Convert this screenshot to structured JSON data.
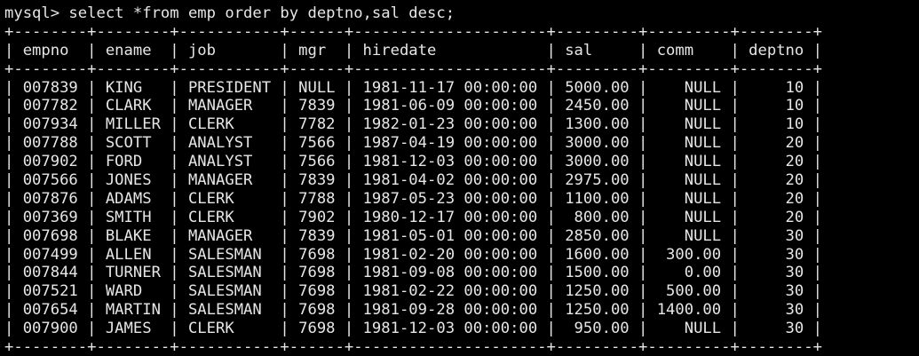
{
  "terminal": {
    "prompt": "mysql> select *from emp order by deptno,sal desc;",
    "border": "+--------+--------+-----------+------+---------------------+---------+---------+--------+",
    "header_row": "| empno  | ename  | job       | mgr  | hiredate            | sal     | comm    | deptno |",
    "columns": [
      "empno",
      "ename",
      "job",
      "mgr",
      "hiredate",
      "sal",
      "comm",
      "deptno"
    ],
    "rows": [
      "| 007839 | KING   | PRESIDENT | NULL | 1981-11-17 00:00:00 | 5000.00 |    NULL |     10 |",
      "| 007782 | CLARK  | MANAGER   | 7839 | 1981-06-09 00:00:00 | 2450.00 |    NULL |     10 |",
      "| 007934 | MILLER | CLERK     | 7782 | 1982-01-23 00:00:00 | 1300.00 |    NULL |     10 |",
      "| 007788 | SCOTT  | ANALYST   | 7566 | 1987-04-19 00:00:00 | 3000.00 |    NULL |     20 |",
      "| 007902 | FORD   | ANALYST   | 7566 | 1981-12-03 00:00:00 | 3000.00 |    NULL |     20 |",
      "| 007566 | JONES  | MANAGER   | 7839 | 1981-04-02 00:00:00 | 2975.00 |    NULL |     20 |",
      "| 007876 | ADAMS  | CLERK     | 7788 | 1987-05-23 00:00:00 | 1100.00 |    NULL |     20 |",
      "| 007369 | SMITH  | CLERK     | 7902 | 1980-12-17 00:00:00 |  800.00 |    NULL |     20 |",
      "| 007698 | BLAKE  | MANAGER   | 7839 | 1981-05-01 00:00:00 | 2850.00 |    NULL |     30 |",
      "| 007499 | ALLEN  | SALESMAN  | 7698 | 1981-02-20 00:00:00 | 1600.00 |  300.00 |     30 |",
      "| 007844 | TURNER | SALESMAN  | 7698 | 1981-09-08 00:00:00 | 1500.00 |    0.00 |     30 |",
      "| 007521 | WARD   | SALESMAN  | 7698 | 1981-02-22 00:00:00 | 1250.00 |  500.00 |     30 |",
      "| 007654 | MARTIN | SALESMAN  | 7698 | 1981-09-28 00:00:00 | 1250.00 | 1400.00 |     30 |",
      "| 007900 | JAMES  | CLERK     | 7698 | 1981-12-03 00:00:00 |  950.00 |    NULL |     30 |"
    ],
    "colors": {
      "background": "#000000",
      "text": "#e6e6e6"
    }
  }
}
